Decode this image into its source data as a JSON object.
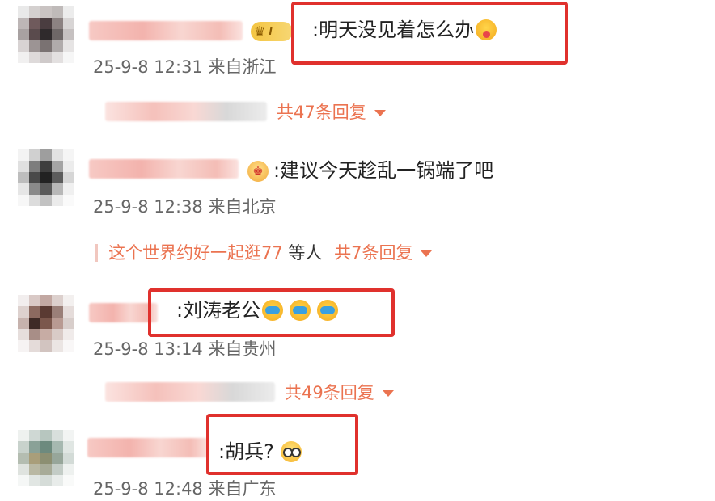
{
  "comments": [
    {
      "text": ":明天没见着怎么办",
      "emoji": "tongue-out-emoji",
      "time": "25-9-8 12:31",
      "location": "来自浙江",
      "replies": {
        "count_label": "共47条回复"
      },
      "badge": {
        "crown": "♛",
        "level": "I"
      }
    },
    {
      "text": ":建议今天趁乱一锅端了吧",
      "time": "25-9-8 12:38",
      "location": "来自北京",
      "replies": {
        "preview_name": "这个世界约好一起逛77",
        "preview_suffix": "等人",
        "count_label": "共7条回复"
      },
      "badge": {
        "crown": "♚"
      }
    },
    {
      "text": ":刘涛老公",
      "emoji": "crying-laughing-emoji",
      "time": "25-9-8 13:14",
      "location": "来自贵州",
      "replies": {
        "count_label": "共49条回复"
      }
    },
    {
      "text": ":胡兵?",
      "emoji": "glasses-emoji",
      "time": "25-9-8 12:48",
      "location": "来自广东"
    }
  ],
  "colors": {
    "highlight_border": "#e0312d",
    "reply_link": "#eb7350",
    "meta_text": "#666666",
    "body_text": "#222222"
  }
}
